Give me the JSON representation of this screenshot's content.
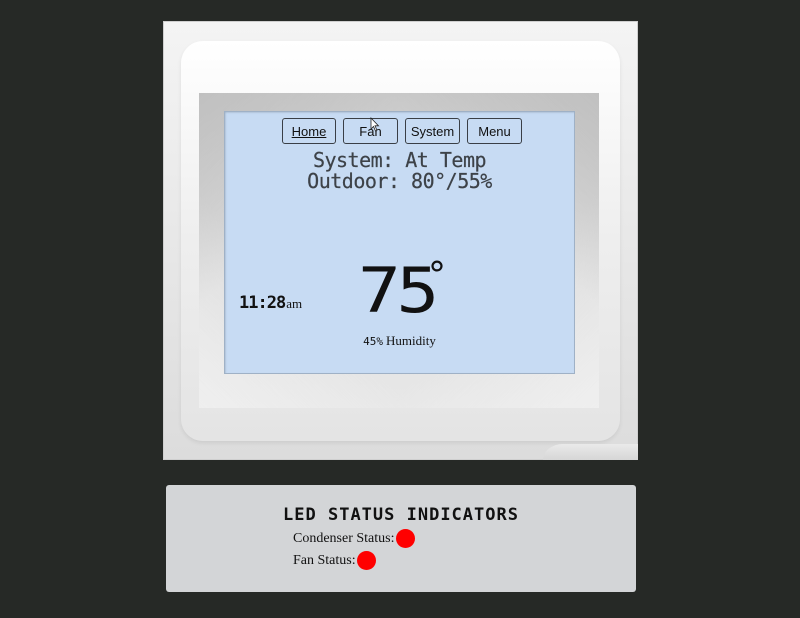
{
  "thermostat": {
    "nav": {
      "home": "Home",
      "fan": "Fan",
      "system": "System",
      "menu": "Menu"
    },
    "status_line": "System: At Temp",
    "outdoor_line": "Outdoor: 80°/55%",
    "clock": {
      "time": "11:28",
      "ampm": "am"
    },
    "temperature": {
      "value": "75",
      "unit": "°"
    },
    "humidity": {
      "percent": "45%",
      "label": "Humidity"
    },
    "colors": {
      "screen": "#c7dbf3",
      "background": "#262926"
    }
  },
  "led_panel": {
    "title": "LED STATUS INDICATORS",
    "condenser_label": "Condenser Status:",
    "condenser_color": "#ff0000",
    "fan_label": "Fan Status:",
    "fan_color": "#ff0000"
  }
}
